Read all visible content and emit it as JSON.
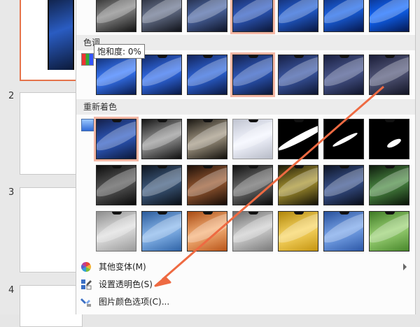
{
  "slides": {
    "numbers": [
      "2",
      "3",
      "4"
    ]
  },
  "sections": {
    "color_tone": "色调",
    "recolor": "重新着色"
  },
  "tooltip": "饱和度: 0%",
  "menu_items": [
    {
      "label": "其他变体(M)",
      "icon": "color-wheel-icon",
      "has_submenu": true
    },
    {
      "label": "设置透明色(S)",
      "icon": "set-transparent-color-icon",
      "has_submenu": false
    },
    {
      "label": "图片颜色选项(C)...",
      "icon": "picture-color-options-icon",
      "has_submenu": false
    }
  ],
  "colors": {
    "accent": "#e5734b",
    "selection": "#f4b8a6",
    "arrow": "#ee6a42"
  }
}
